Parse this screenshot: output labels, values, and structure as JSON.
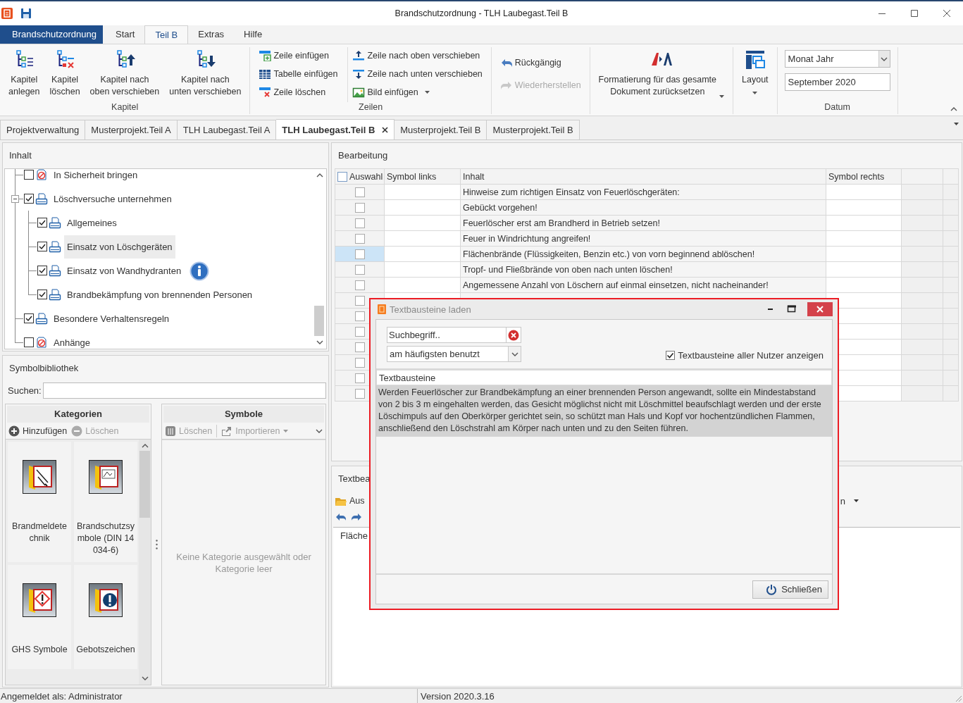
{
  "window": {
    "title": "Brandschutzordnung - TLH Laubegast.Teil B"
  },
  "ribbon_tabs": [
    {
      "label": "Brandschutzordnung",
      "kind": "file",
      "selected": false
    },
    {
      "label": "Start",
      "kind": "tab",
      "selected": false
    },
    {
      "label": "Teil B",
      "kind": "tab",
      "selected": true
    },
    {
      "label": "Extras",
      "kind": "tab",
      "selected": false
    },
    {
      "label": "Hilfe",
      "kind": "tab",
      "selected": false
    }
  ],
  "ribbon": {
    "groups": [
      {
        "kind": "large",
        "label": "Kapitel",
        "buttons": [
          {
            "label": "Kapitel\nanlegen",
            "dropdown": false
          },
          {
            "label": "Kapitel\nlöschen",
            "dropdown": false
          },
          {
            "label": "Kapitel nach\noben verschieben",
            "dropdown": false
          },
          {
            "label": "Kapitel nach\nunten verschieben",
            "dropdown": false
          }
        ]
      },
      {
        "kind": "small",
        "label": "Zeilen",
        "columns": [
          [
            {
              "label": "Zeile einfügen",
              "dropdown": false
            },
            {
              "label": "Tabelle einfügen",
              "dropdown": false
            },
            {
              "label": "Zeile löschen",
              "dropdown": false
            }
          ],
          [
            {
              "label": "Zeile nach oben verschieben",
              "dropdown": false
            },
            {
              "label": "Zeile nach unten verschieben",
              "dropdown": false
            },
            {
              "label": "Bild einfügen",
              "dropdown": true
            }
          ]
        ]
      },
      {
        "kind": "history",
        "buttons": [
          {
            "label": "Rückgängig",
            "disabled": false
          },
          {
            "label": "Wiederherstellen",
            "disabled": true
          }
        ]
      },
      {
        "kind": "large",
        "buttons": [
          {
            "label": "Formatierung für das gesamte\nDokument zurücksetzen",
            "dropdown": true
          }
        ]
      },
      {
        "kind": "large",
        "buttons": [
          {
            "label": "Layout",
            "dropdown": true
          }
        ]
      },
      {
        "kind": "date",
        "label": "Datum",
        "format": "Monat Jahr",
        "value": "September 2020"
      }
    ]
  },
  "doc_tabs": [
    {
      "label": "Projektverwaltung",
      "selected": false
    },
    {
      "label": "Musterprojekt.Teil A",
      "selected": false
    },
    {
      "label": "TLH Laubegast.Teil A",
      "selected": false
    },
    {
      "label": "TLH Laubegast.Teil B",
      "selected": true
    },
    {
      "label": "Musterprojekt.Teil B",
      "selected": false
    },
    {
      "label": "Musterprojekt.Teil B",
      "selected": false
    }
  ],
  "contents": {
    "title": "Inhalt",
    "items": [
      {
        "label": "In Sicherheit bringen",
        "kind": "excluded",
        "checked": false,
        "selected": false
      },
      {
        "label": "Löschversuche unternehmen",
        "kind": "printed",
        "checked": true,
        "selected": false,
        "expanded": true,
        "children": [
          {
            "label": "Allgemeines",
            "kind": "printed",
            "checked": true,
            "selected": false
          },
          {
            "label": "Einsatz von Löschgeräten",
            "kind": "printed",
            "checked": true,
            "selected": true
          },
          {
            "label": "Einsatz von Wandhydranten",
            "kind": "printed",
            "checked": true,
            "selected": false
          },
          {
            "label": "Brandbekämpfung von brennenden Personen",
            "kind": "printed",
            "checked": true,
            "selected": false
          }
        ]
      },
      {
        "label": "Besondere Verhaltensregeln",
        "kind": "printed",
        "checked": true,
        "selected": false
      },
      {
        "label": "Anhänge",
        "kind": "excluded",
        "checked": false,
        "selected": false
      }
    ]
  },
  "symbol_library": {
    "title": "Symbolbibliothek",
    "search_label": "Suchen:",
    "categories": {
      "title": "Kategorien",
      "actions": [
        {
          "label": "Hinzufügen",
          "disabled": false
        },
        {
          "label": "Löschen",
          "disabled": true
        }
      ],
      "items": [
        {
          "label": "Brandmeldetechnik"
        },
        {
          "label": "Brandschutzsymbole (DIN 14034-6)"
        },
        {
          "label": "GHS Symbole"
        },
        {
          "label": "Gebotszeichen"
        }
      ]
    },
    "symbols": {
      "title": "Symbole",
      "actions": [
        {
          "label": "Löschen",
          "disabled": true,
          "dropdown": false
        },
        {
          "label": "Importieren",
          "disabled": true,
          "dropdown": true
        }
      ],
      "empty_message": "Keine Kategorie ausgewählt oder Kategorie leer"
    }
  },
  "editing": {
    "title": "Bearbeitung",
    "header_checked": false,
    "columns": [
      "Auswahl",
      "Symbol links",
      "Inhalt",
      "Symbol rechts"
    ],
    "rows": [
      {
        "content": "Hinweise zum richtigen Einsatz von Feuerlöschgeräten:",
        "checked": false,
        "selected": false
      },
      {
        "content": "Gebückt vorgehen!",
        "checked": false,
        "selected": false
      },
      {
        "content": "Feuerlöscher erst am Brandherd in Betrieb setzen!",
        "checked": false,
        "selected": false
      },
      {
        "content": "Feuer in Windrichtung angreifen!",
        "checked": false,
        "selected": false
      },
      {
        "content": "Flächenbrände (Flüssigkeiten, Benzin etc.) von vorn beginnend ablöschen!",
        "checked": false,
        "selected": true
      },
      {
        "content": "Tropf- und Fließbrände von oben nach unten löschen!",
        "checked": false,
        "selected": false
      },
      {
        "content": "Angemessene Anzahl von Löschern auf einmal einsetzen, nicht nacheinander!",
        "checked": false,
        "selected": false
      },
      {
        "checked": false,
        "selected": false
      },
      {
        "checked": false,
        "selected": false
      },
      {
        "checked": false,
        "selected": false
      },
      {
        "checked": false,
        "selected": false
      },
      {
        "checked": false,
        "selected": false
      },
      {
        "checked": false,
        "selected": false
      },
      {
        "checked": false,
        "selected": false
      }
    ]
  },
  "text_editor": {
    "title": "Textbea",
    "toolbar_label": "Aus",
    "toolbar_right": "n",
    "content": "Fläche"
  },
  "dialog": {
    "title": "Textbausteine laden",
    "search_placeholder": "Suchbegriff..",
    "sort": "am häufigsten benutzt",
    "show_all_users": {
      "label": "Textbausteine aller Nutzer anzeigen",
      "checked": true
    },
    "list_title": "Textbausteine",
    "items": [
      {
        "text": "Werden Feuerlöscher zur Brandbekämpfung an einer brennenden Person angewandt, sollte ein Mindestabstand von 2 bis 3 m eingehalten werden, das Gesicht möglichst nicht mit Löschmittel beaufschlagt werden und der erste Löschimpuls auf den Oberkörper gerichtet sein, so schützt man Hals und Kopf vor hochentzündlichen Flammen, anschließend den Löschstrahl am Körper nach unten und zu den Seiten führen.",
        "selected": true
      }
    ],
    "close_button": "Schließen"
  },
  "status_bar": {
    "user": "Angemeldet als: Administrator",
    "version": "Version 2020.3.16"
  }
}
